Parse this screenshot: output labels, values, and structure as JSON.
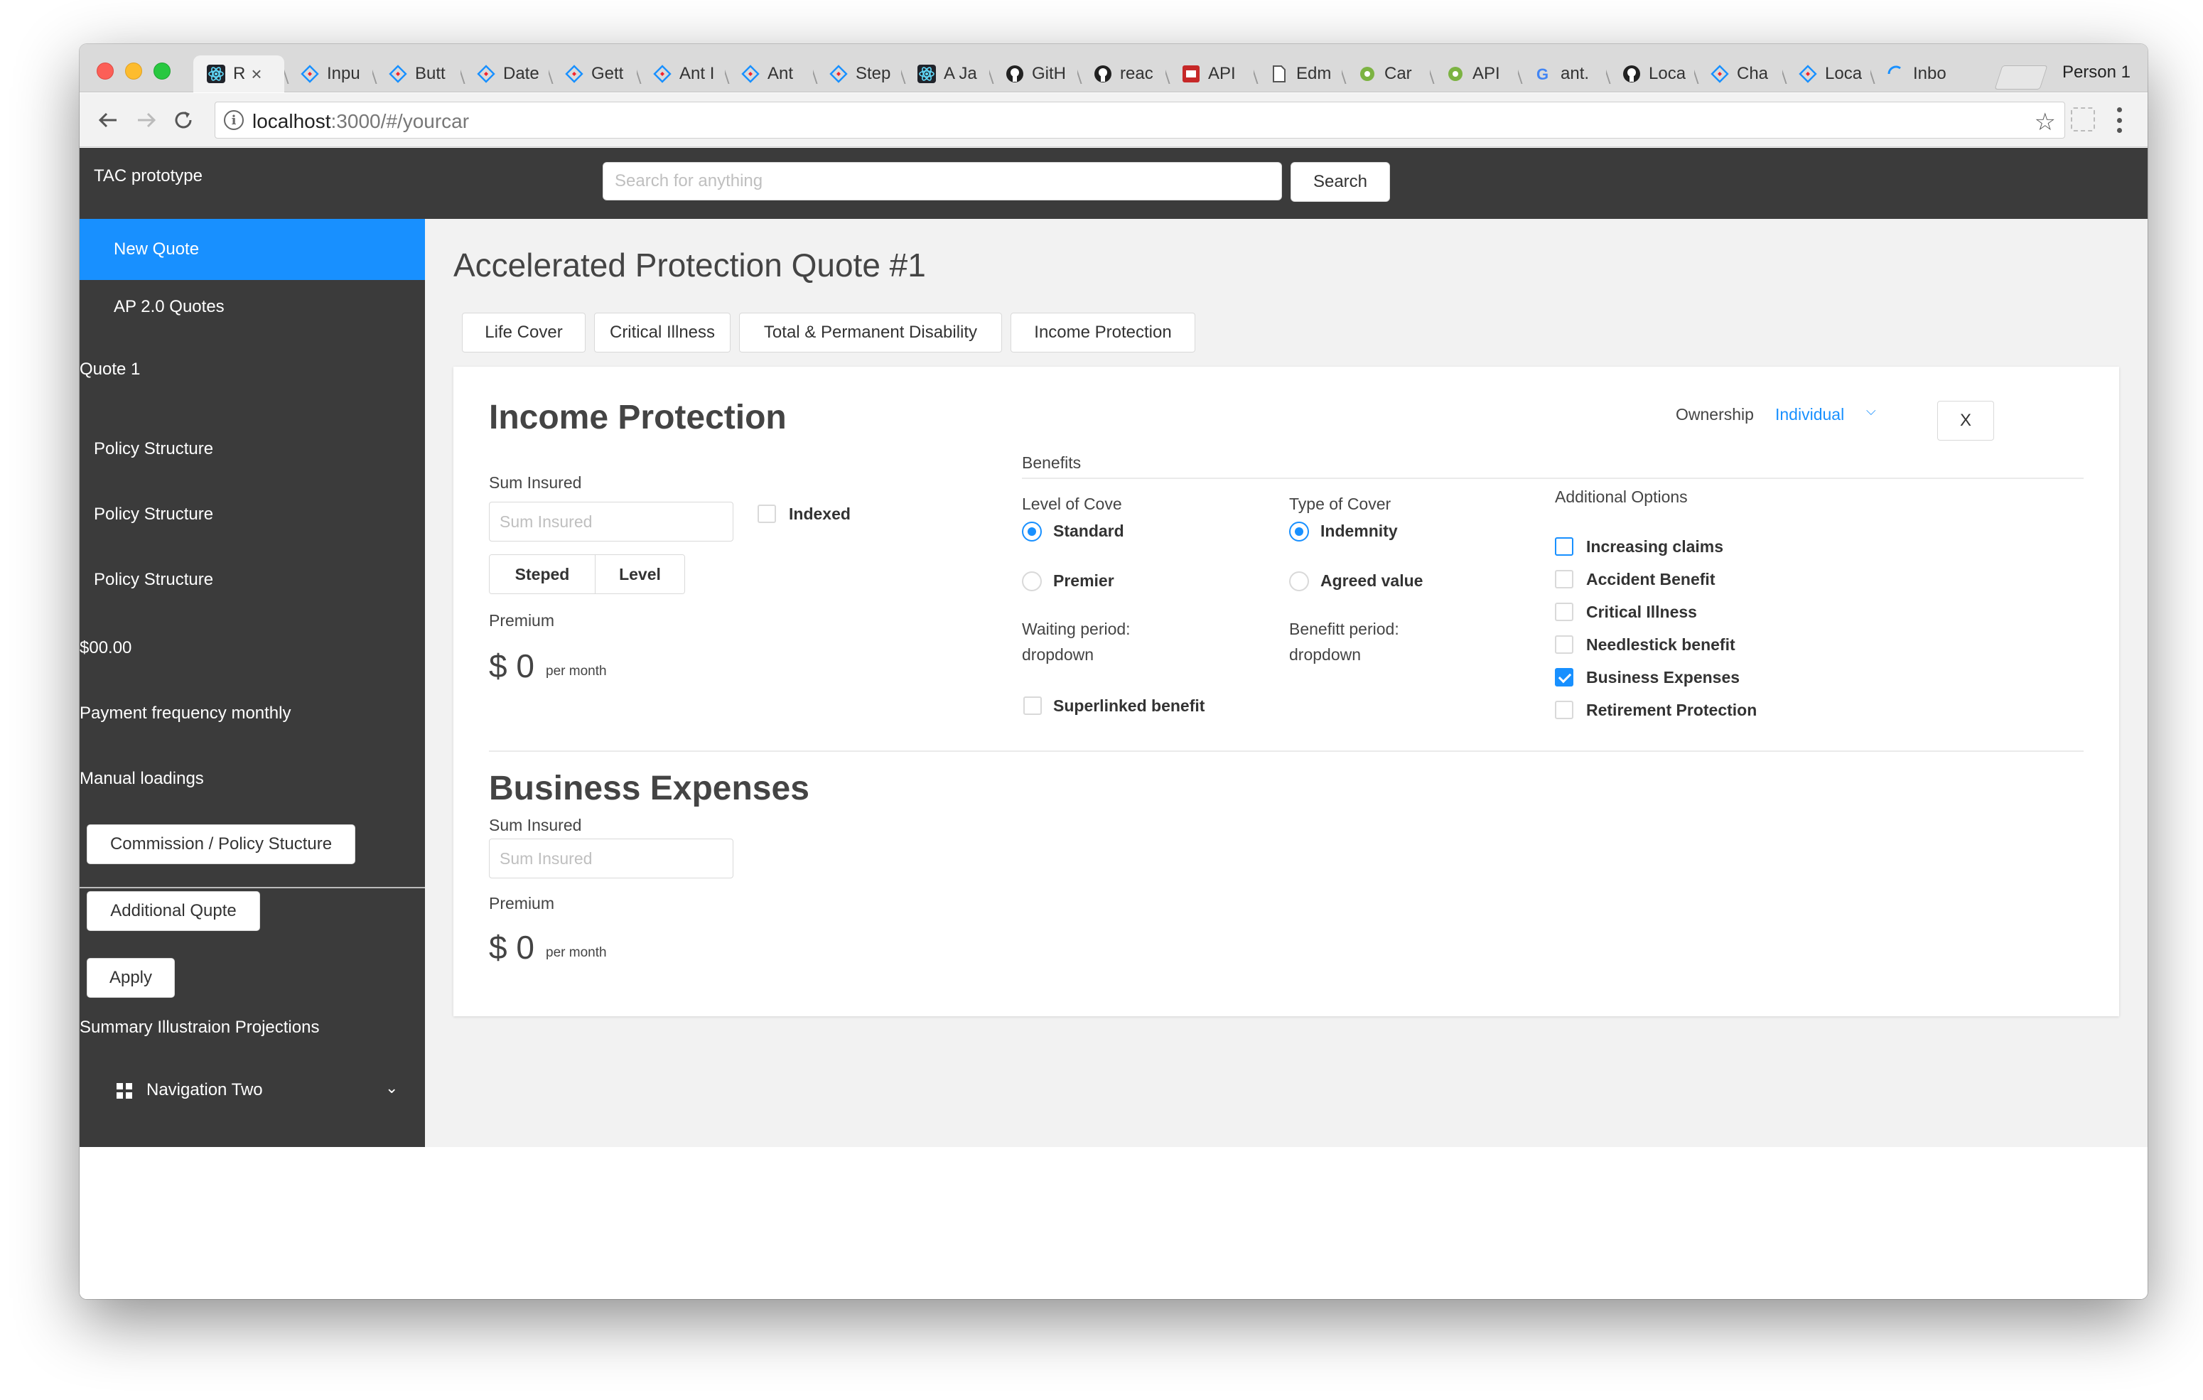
{
  "browser": {
    "tabs": [
      {
        "title": "R",
        "icon": "react-icon"
      },
      {
        "title": "Inpu",
        "icon": "antd-icon"
      },
      {
        "title": "Butt",
        "icon": "antd-icon"
      },
      {
        "title": "Date",
        "icon": "antd-icon"
      },
      {
        "title": "Gett",
        "icon": "antd-icon"
      },
      {
        "title": "Ant I",
        "icon": "antd-icon"
      },
      {
        "title": "Ant",
        "icon": "antd-icon"
      },
      {
        "title": "Step",
        "icon": "antd-icon"
      },
      {
        "title": "A Ja",
        "icon": "react-icon"
      },
      {
        "title": "GitH",
        "icon": "github-icon"
      },
      {
        "title": "reac",
        "icon": "github-icon"
      },
      {
        "title": "API",
        "icon": "api-icon"
      },
      {
        "title": "Edm",
        "icon": "document-icon"
      },
      {
        "title": "Car",
        "icon": "gear-icon"
      },
      {
        "title": "API",
        "icon": "gear-icon"
      },
      {
        "title": "ant.",
        "icon": "google-icon"
      },
      {
        "title": "Loca",
        "icon": "github-icon"
      },
      {
        "title": "Cha",
        "icon": "antd-icon"
      },
      {
        "title": "Loca",
        "icon": "antd-icon"
      },
      {
        "title": "Inbo",
        "icon": "loading-icon"
      }
    ],
    "tab_close": "×",
    "profile": "Person 1",
    "url_host": "localhost",
    "url_rest": ":3000/#/yourcar"
  },
  "app": {
    "brand": "TAC prototype",
    "search_placeholder": "Search for anything",
    "search_button": "Search"
  },
  "sidebar": {
    "new_quote": "New Quote",
    "ap_quotes": "AP 2.0 Quotes",
    "quote1": "Quote 1",
    "policy_structure_1": "Policy Structure",
    "policy_structure_2": "Policy Structure",
    "policy_structure_3": "Policy Structure",
    "amount": "$00.00",
    "payment_frequency": "Payment frequency monthly",
    "manual_loadings": "Manual loadings",
    "commission_button": "Commission / Policy Stucture",
    "additional_quote_button": "Additional Qupte",
    "apply_button": "Apply",
    "summary": "Summary Illustraion Projections",
    "nav_two": "Navigation Two"
  },
  "main": {
    "title": "Accelerated Protection Quote #1",
    "tabs": [
      "Life Cover",
      "Critical Illness",
      "Total & Permanent Disability",
      "Income Protection"
    ],
    "income": {
      "heading": "Income Protection",
      "sum_insured_label": "Sum Insured",
      "sum_insured_placeholder": "Sum Insured",
      "indexed_label": "Indexed",
      "indexed": false,
      "steped": "Steped",
      "level": "Level",
      "premium_label": "Premium",
      "premium_currency": "$",
      "premium_value": "0",
      "premium_unit": "per month",
      "ownership_label": "Ownership",
      "ownership_value": "Individual",
      "close": "X",
      "benefits_label": "Benefits",
      "level_of_cover_label": "Level of Cove",
      "level_options": [
        {
          "label": "Standard",
          "checked": true
        },
        {
          "label": "Premier",
          "checked": false
        }
      ],
      "type_of_cover_label": "Type of Cover",
      "type_options": [
        {
          "label": "Indemnity",
          "checked": true
        },
        {
          "label": "Agreed value",
          "checked": false
        }
      ],
      "waiting_period_label": "Waiting period:",
      "waiting_period_value": "dropdown",
      "benefit_period_label": "Benefitt period:",
      "benefit_period_value": "dropdown",
      "superlinked_label": "Superlinked benefit",
      "superlinked": false,
      "additional_options_label": "Additional Options",
      "additional_options": [
        {
          "label": "Increasing claims",
          "checked": false
        },
        {
          "label": "Accident Benefit",
          "checked": false
        },
        {
          "label": "Critical Illness",
          "checked": false
        },
        {
          "label": "Needlestick benefit",
          "checked": false
        },
        {
          "label": "Business Expenses",
          "checked": true
        },
        {
          "label": "Retirement Protection",
          "checked": false
        }
      ]
    },
    "business": {
      "heading": "Business Expenses",
      "sum_insured_label": "Sum Insured",
      "sum_insured_placeholder": "Sum Insured",
      "premium_label": "Premium",
      "premium_currency": "$",
      "premium_value": "0",
      "premium_unit": "per month"
    }
  },
  "colors": {
    "accent": "#1890ff",
    "sidebar": "#3b3b3b",
    "content_bg": "#f2f2f2"
  }
}
